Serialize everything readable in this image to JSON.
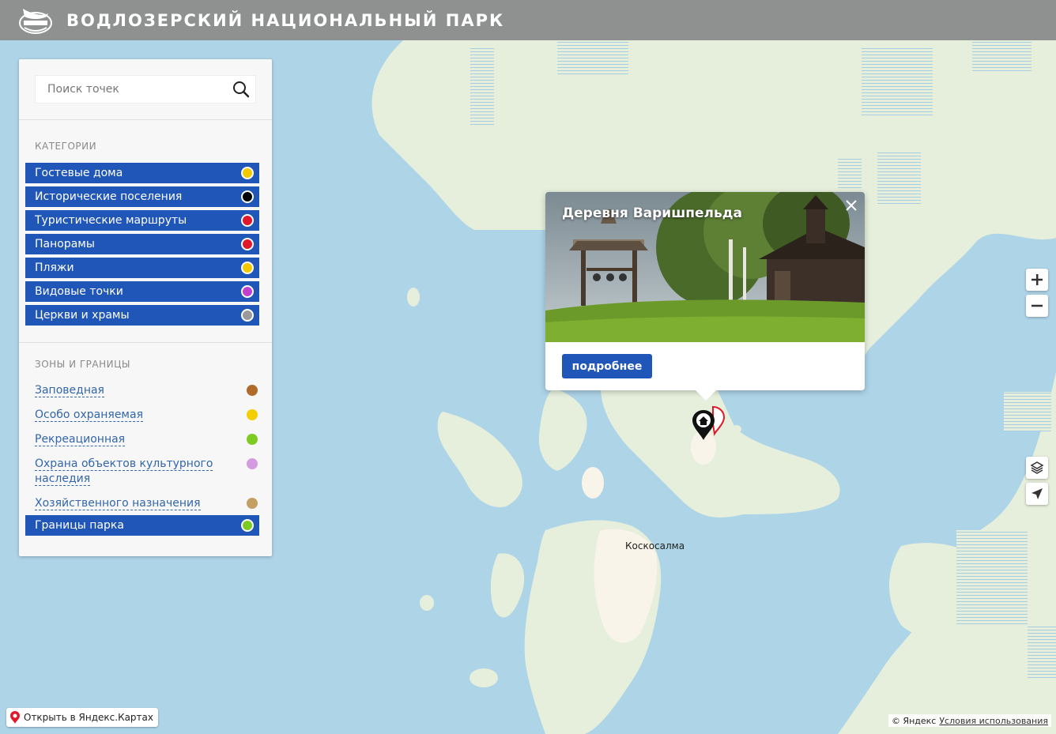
{
  "header": {
    "title": "ВОДЛОЗЕРСКИЙ НАЦИОНАЛЬНЫЙ ПАРК"
  },
  "search": {
    "placeholder": "Поиск точек"
  },
  "categories": {
    "title": "КАТЕГОРИИ",
    "items": [
      {
        "label": "Гостевые дома",
        "color": "#f3c800"
      },
      {
        "label": "Исторические поселения",
        "color": "#000000"
      },
      {
        "label": "Туристические маршруты",
        "color": "#e0182b"
      },
      {
        "label": "Панорамы",
        "color": "#e0182b"
      },
      {
        "label": "Пляжи",
        "color": "#f3c800"
      },
      {
        "label": "Видовые точки",
        "color": "#c23fd0"
      },
      {
        "label": "Церкви и храмы",
        "color": "#9a9a9a"
      }
    ]
  },
  "zones": {
    "title": "ЗОНЫ И ГРАНИЦЫ",
    "items": [
      {
        "label": "Заповедная",
        "color": "#b06a2a"
      },
      {
        "label": "Особо охраняемая",
        "color": "#f3cf00"
      },
      {
        "label": "Рекреационная",
        "color": "#7dcb22"
      },
      {
        "label": "Охрана объектов культурного наследия",
        "color": "#d59be0"
      },
      {
        "label": "Хозяйственного назначения",
        "color": "#c3a062"
      }
    ],
    "park_bounds": {
      "label": "Границы парка",
      "color": "#7dcb22"
    }
  },
  "popup": {
    "title": "Деревня Варишпельда",
    "button": "подробнее"
  },
  "map": {
    "place_label": "Коскосалма",
    "open_link": "Открыть в Яндекс.Картах",
    "copyright": "© Яндекс",
    "terms": "Условия использования"
  }
}
